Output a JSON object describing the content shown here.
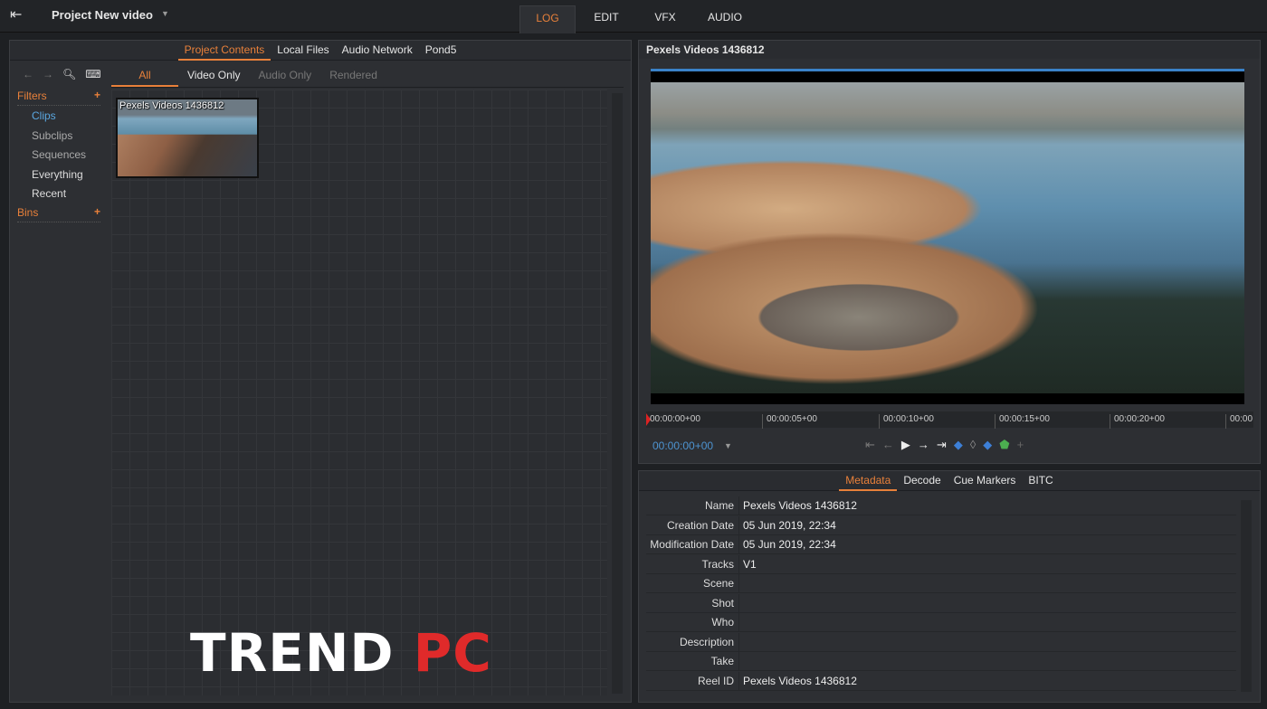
{
  "header": {
    "exit_icon": "exit-icon",
    "project_title": "Project New video",
    "modes": [
      {
        "label": "LOG",
        "active": true
      },
      {
        "label": "EDIT"
      },
      {
        "label": "VFX"
      },
      {
        "label": "AUDIO"
      }
    ]
  },
  "browser": {
    "tabs": [
      {
        "label": "Project Contents",
        "active": true
      },
      {
        "label": "Local Files"
      },
      {
        "label": "Audio Network"
      },
      {
        "label": "Pond5"
      }
    ],
    "subtabs": [
      {
        "label": "All",
        "active": true
      },
      {
        "label": "Video Only"
      },
      {
        "label": "Audio Only",
        "disabled": true
      },
      {
        "label": "Rendered",
        "disabled": true
      }
    ],
    "filters_label": "Filters",
    "bins_label": "Bins",
    "filters": [
      {
        "label": "Clips",
        "selected": true
      },
      {
        "label": "Subclips",
        "dim": true
      },
      {
        "label": "Sequences",
        "dim": true
      },
      {
        "label": "Everything"
      },
      {
        "label": "Recent"
      }
    ],
    "clip": {
      "name": "Pexels Videos 1436812"
    }
  },
  "viewer": {
    "title": "Pexels Videos 1436812",
    "timecode": "00:00:00+00",
    "ruler": [
      "00:00:00+00",
      "00:00:05+00",
      "00:00:10+00",
      "00:00:15+00",
      "00:00:20+00",
      "00:00"
    ]
  },
  "metadata": {
    "tabs": [
      {
        "label": "Metadata",
        "active": true
      },
      {
        "label": "Decode"
      },
      {
        "label": "Cue Markers"
      },
      {
        "label": "BITC"
      }
    ],
    "rows": [
      {
        "k": "Name",
        "v": "Pexels Videos 1436812"
      },
      {
        "k": "Creation Date",
        "v": "05 Jun 2019, 22:34"
      },
      {
        "k": "Modification Date",
        "v": "05 Jun 2019, 22:34"
      },
      {
        "k": "Tracks",
        "v": "V1"
      },
      {
        "k": "Scene",
        "v": ""
      },
      {
        "k": "Shot",
        "v": ""
      },
      {
        "k": "Who",
        "v": ""
      },
      {
        "k": "Description",
        "v": ""
      },
      {
        "k": "Take",
        "v": ""
      },
      {
        "k": "Reel ID",
        "v": "Pexels Videos 1436812"
      }
    ]
  },
  "watermark": {
    "text_a": "TREND",
    "text_b": "PC"
  },
  "colors": {
    "accent": "#e8803a",
    "timecode": "#4d93d0"
  }
}
